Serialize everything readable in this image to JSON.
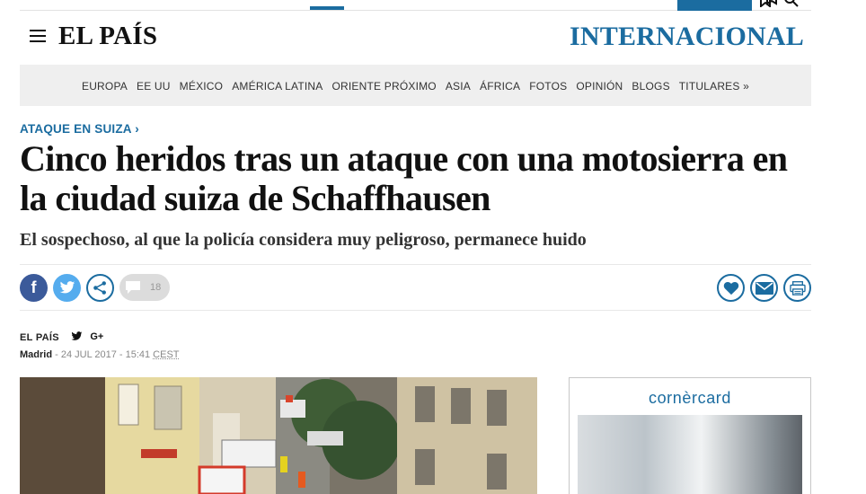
{
  "header": {
    "logo": "EL PAÍS",
    "section": "INTERNACIONAL"
  },
  "nav": {
    "items": [
      "EUROPA",
      "EE UU",
      "MÉXICO",
      "AMÉRICA LATINA",
      "ORIENTE PRÓXIMO",
      "ASIA",
      "ÁFRICA",
      "FOTOS",
      "OPINIÓN",
      "BLOGS",
      "TITULARES »"
    ]
  },
  "article": {
    "kicker": "ATAQUE EN SUIZA ›",
    "headline": "Cinco heridos tras un ataque con una motosierra en la ciudad suiza de Schaffhausen",
    "subhead": "El sospechoso, al que la policía considera muy peligroso, permanece huido",
    "byline_source": "EL PAÍS",
    "byline_gplus": "G+",
    "dateline_city": "Madrid",
    "dateline_date": " - 24 JUL 2017 - 15:41 ",
    "dateline_tz": "CEST"
  },
  "share": {
    "facebook_label": "f",
    "comment_count": "18"
  },
  "ad": {
    "brand": "cornèrcard"
  },
  "colors": {
    "accent": "#1b6ca0",
    "facebook": "#3b5a9a",
    "twitter": "#55acee"
  }
}
